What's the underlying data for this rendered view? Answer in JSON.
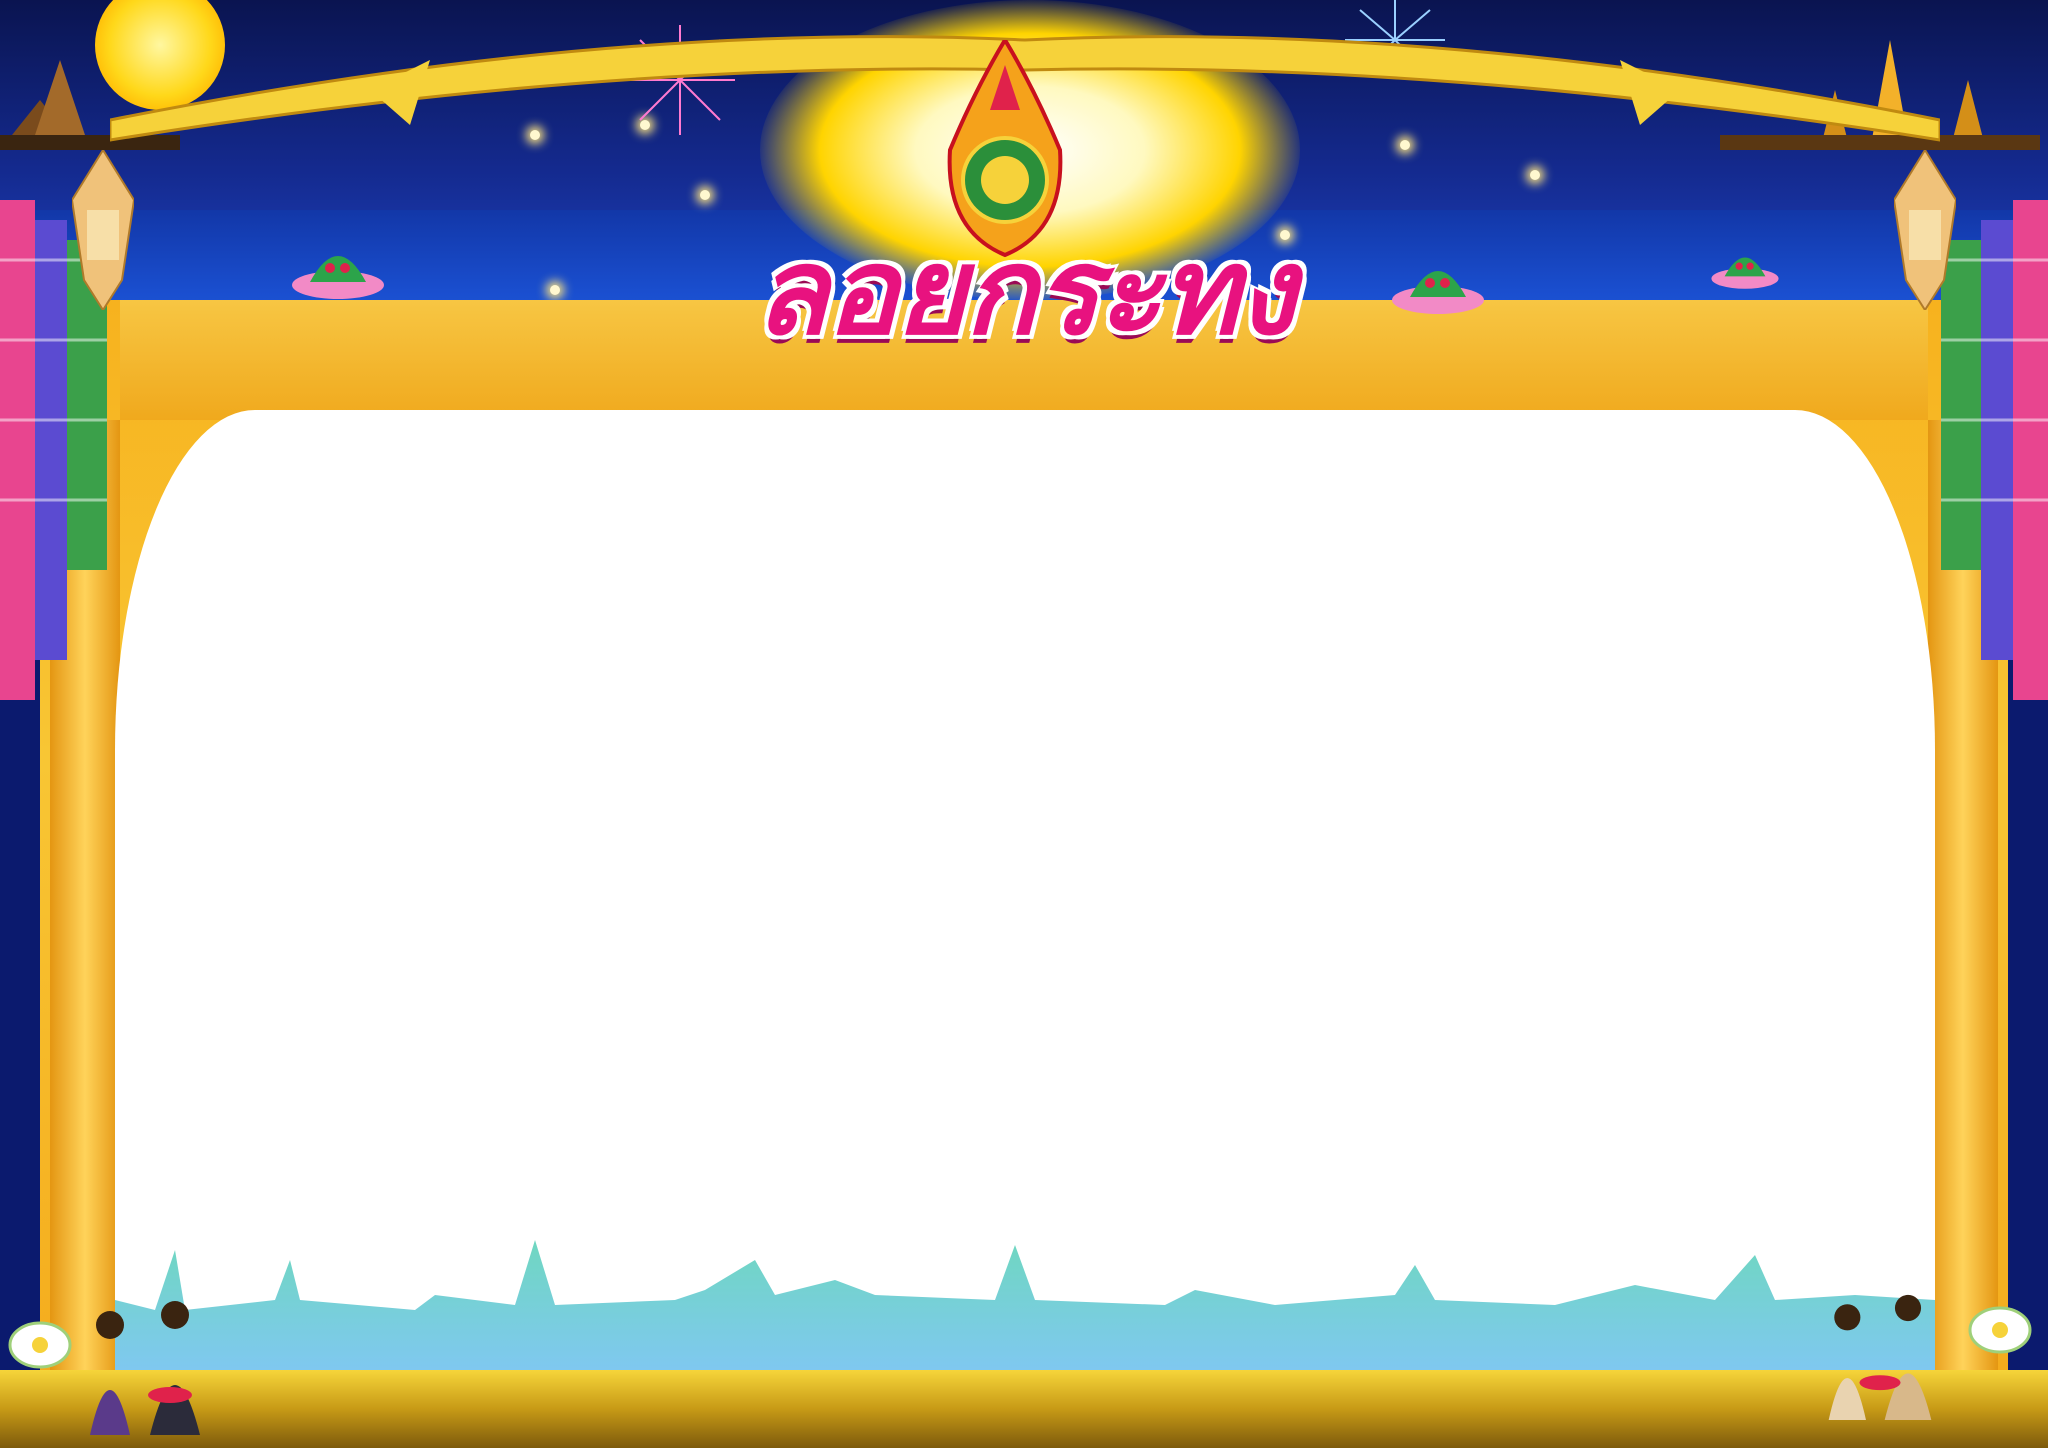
{
  "title": "ลอยกระทง",
  "colors": {
    "sky": "#142a8f",
    "river": "#1a4fd0",
    "curtain_gold": "#f7b21e",
    "title_pink": "#e8127f",
    "stage_white": "#ffffff",
    "skyline_teal": "#5ed6c8",
    "water_gold": "#f6d53a"
  },
  "decorations": {
    "seal_icon": "school-emblem-icon",
    "moon_icon": "full-moon-icon",
    "krathong_icon": "krathong-icon",
    "lantern_icon": "lanna-lantern-icon",
    "cloth_icon": "woven-cloth-icon",
    "temple_icon": "temple-icon",
    "lotus_icon": "lotus-icon",
    "dancers_icon": "thai-dancers-icon",
    "firework_icon": "firework-icon"
  }
}
